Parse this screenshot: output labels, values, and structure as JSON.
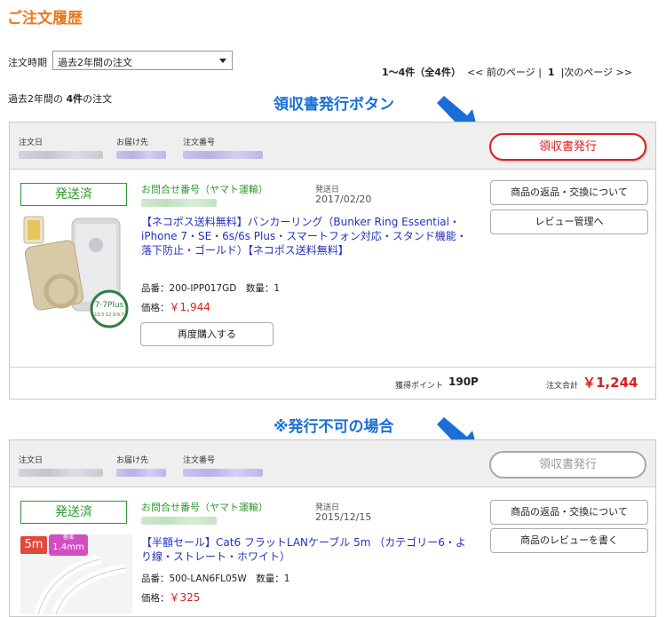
{
  "page": {
    "title": "ご注文履歴",
    "period_label": "注文時期",
    "period_select": "過去2年間の注文",
    "pager": {
      "range": "1〜4件（全4件）",
      "prev": "<< 前のページ",
      "sep1": "|",
      "current": "1",
      "sep2": "|",
      "next": "次のページ >>"
    },
    "summary": {
      "prefix": "過去2年間の",
      "count": "4件",
      "suffix": "の注文"
    }
  },
  "annotations": {
    "receipt_button": "領収書発行ボタン",
    "not_issuable": "※発行不可の場合"
  },
  "colors": {
    "title": "#e8791f",
    "annotation": "#1a6fd6",
    "receipt_active": "#d92020",
    "status_green": "#2e9a2e",
    "product_link": "#2233bb"
  },
  "orders": [
    {
      "head": {
        "order_date_label": "注文日",
        "ship_to_label": "お届け先",
        "order_number_label": "注文番号",
        "receipt_button": "領収書発行"
      },
      "status": "発送済",
      "inquiry_label": "お問合せ番号（ヤマト運輸）",
      "shipped_label": "発送日",
      "shipped_date": "2017/02/20",
      "actions": [
        "商品の返品・交換について",
        "レビュー管理へ"
      ],
      "product": {
        "name": "【ネコポス送料無料】バンカーリング（Bunker Ring Essential・iPhone 7・SE・6s/6s Plus・スマートフォン対応・スタンド機能・落下防止・ゴールド）【ネコポス送料無料】",
        "sku_line": "品番：200-IPP017GD　数量：1",
        "price_label": "価格：",
        "price": "￥1,944",
        "rebuy_button": "再度購入する"
      },
      "footer": {
        "points_label": "獲得ポイント",
        "points_value": "190P",
        "total_label": "注文合計",
        "total_value": "￥1,244"
      }
    },
    {
      "head": {
        "order_date_label": "注文日",
        "ship_to_label": "お届け先",
        "order_number_label": "注文番号",
        "receipt_button": "領収書発行"
      },
      "status": "発送済",
      "inquiry_label": "お問合せ番号（ヤマト運輸）",
      "shipped_label": "発送日",
      "shipped_date": "2015/12/15",
      "actions": [
        "商品の返品・交換について",
        "商品のレビューを書く"
      ],
      "product": {
        "name": "【半額セール】Cat6 フラットLANケーブル 5m （カテゴリー6・より線・ストレート・ホワイト）",
        "sku_line": "品番：500-LAN6FL05W　数量：1",
        "price_label": "価格：",
        "price": "￥325",
        "image_badge_length": "5m",
        "image_badge_thin": "極薄",
        "image_badge_thickness": "1.4mm"
      }
    }
  ]
}
